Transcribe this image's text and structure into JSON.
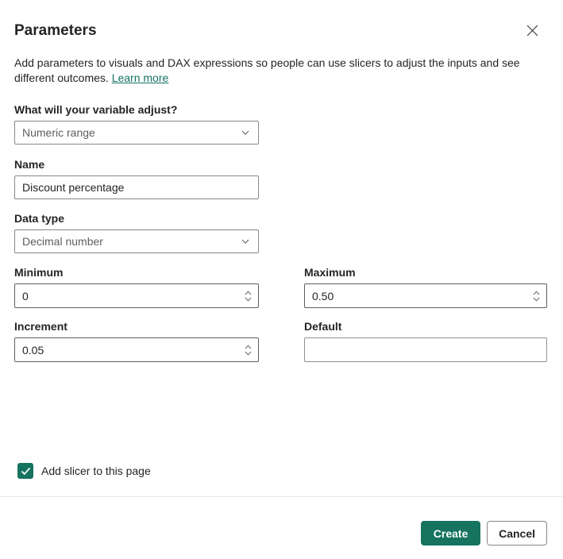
{
  "dialog": {
    "title": "Parameters",
    "description": "Add parameters to visuals and DAX expressions so people can use slicers to adjust the inputs and see different outcomes.",
    "learn_more": "Learn more"
  },
  "fields": {
    "variable_adjust": {
      "label": "What will your variable adjust?",
      "value": "Numeric range"
    },
    "name": {
      "label": "Name",
      "value": "Discount percentage"
    },
    "data_type": {
      "label": "Data type",
      "value": "Decimal number"
    },
    "minimum": {
      "label": "Minimum",
      "value": "0"
    },
    "maximum": {
      "label": "Maximum",
      "value": "0.50"
    },
    "increment": {
      "label": "Increment",
      "value": "0.05"
    },
    "default": {
      "label": "Default",
      "value": ""
    }
  },
  "checkbox": {
    "label": "Add slicer to this page",
    "checked": true
  },
  "buttons": {
    "create": "Create",
    "cancel": "Cancel"
  },
  "icons": {
    "close": "close-icon",
    "dropdown": "chevron-down-icon",
    "spin_up": "chevron-up-icon",
    "spin_down": "chevron-down-icon",
    "check": "checkmark-icon"
  },
  "colors": {
    "accent": "#15735F",
    "text": "#252423",
    "muted_text": "#605E5C",
    "input_border": "#8A8886",
    "spin_border": "#605E5C",
    "divider": "#E8E8E8"
  }
}
